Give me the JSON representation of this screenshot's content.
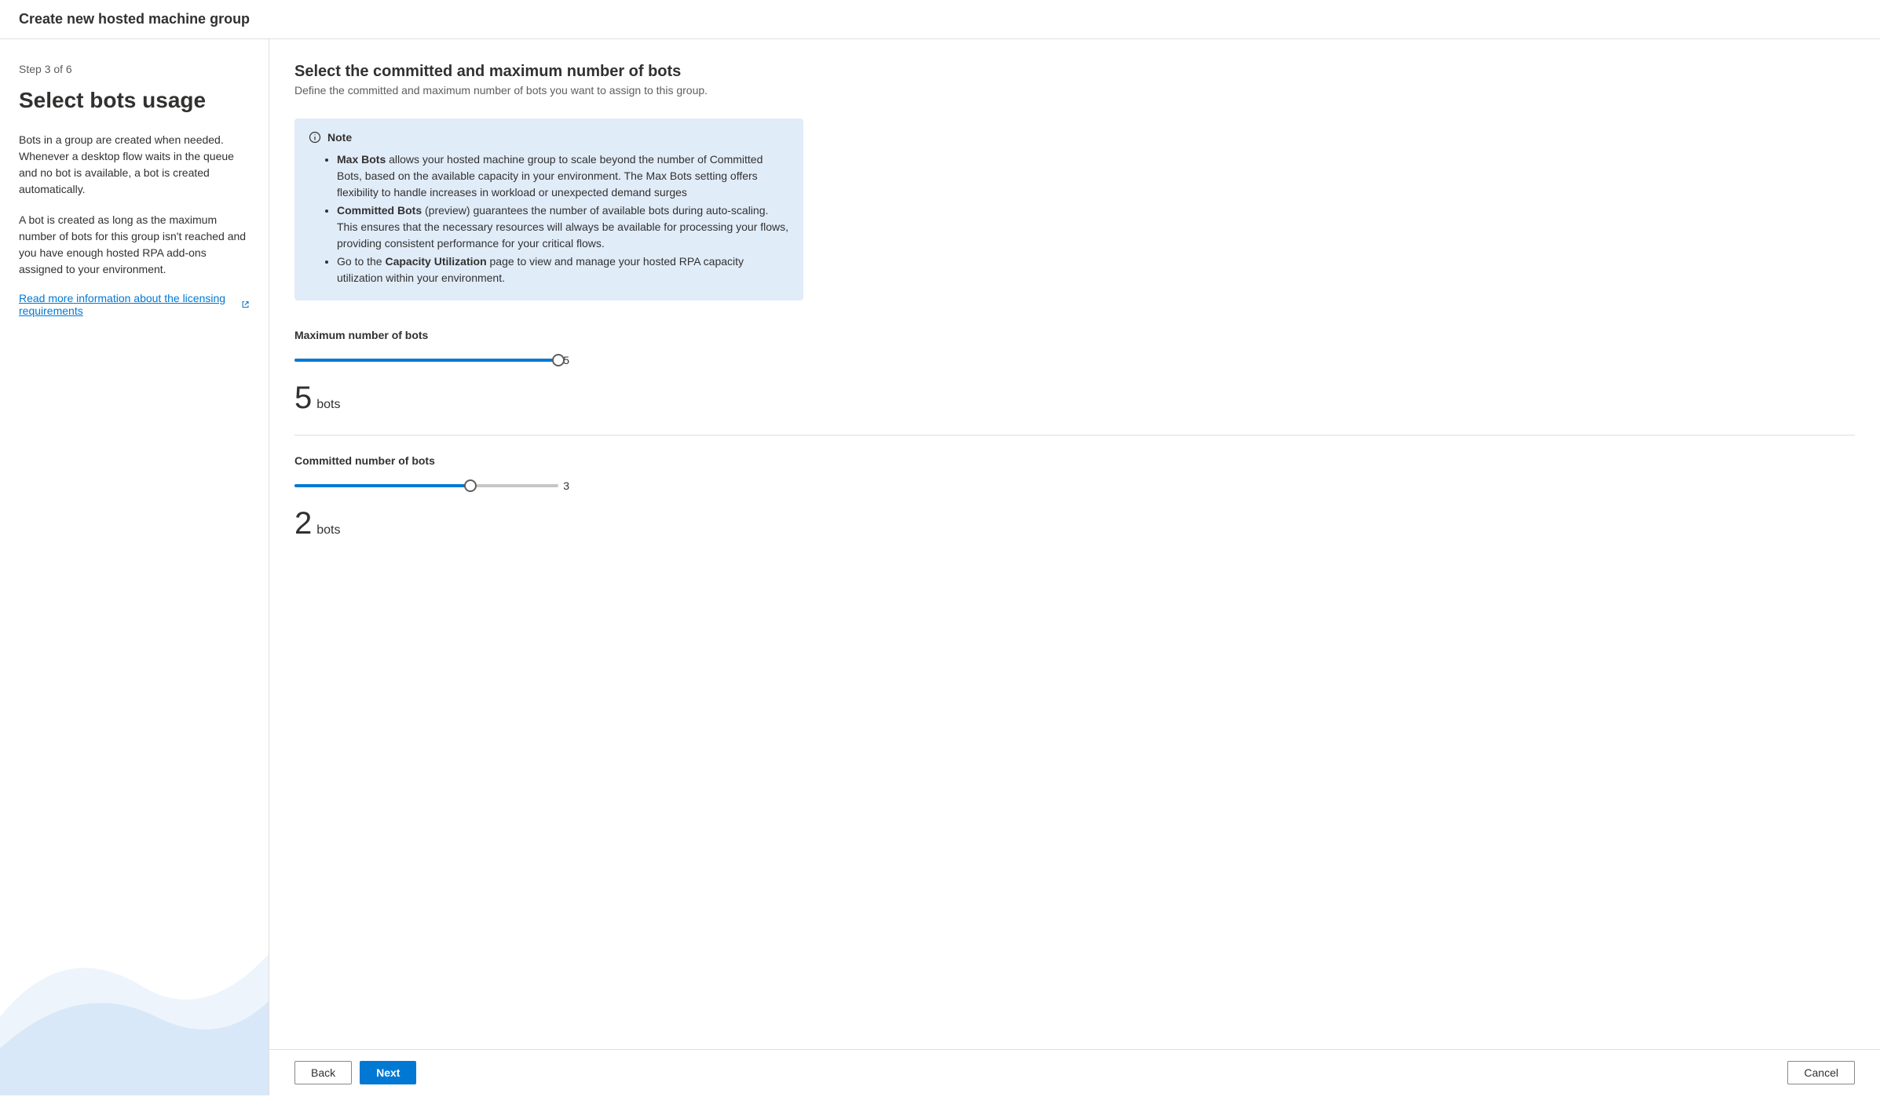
{
  "header": {
    "title": "Create new hosted machine group"
  },
  "sidebar": {
    "step_indicator": "Step 3 of 6",
    "title": "Select bots usage",
    "paragraph1": "Bots in a group are created when needed. Whenever a desktop flow waits in the queue and no bot is available, a bot is created automatically.",
    "paragraph2": "A bot is created as long as the maximum number of bots for this group isn't reached and you have enough hosted RPA add-ons assigned to your environment.",
    "link_text": "Read more information about the licensing requirements"
  },
  "main": {
    "title": "Select the committed and maximum number of bots",
    "subtitle": "Define the committed and maximum number of bots you want to assign to this group."
  },
  "note": {
    "label": "Note",
    "items": [
      {
        "bold": "Max Bots",
        "text": " allows your hosted machine group to scale beyond the number of Committed Bots, based on the available capacity in your environment. The Max Bots setting offers flexibility to handle increases in workload or unexpected demand surges"
      },
      {
        "bold": "Committed Bots",
        "text": " (preview) guarantees the number of available bots during auto-scaling. This ensures that the necessary resources will always be available for processing your flows, providing consistent performance for your critical flows."
      },
      {
        "prefix": "Go to the ",
        "bold": "Capacity Utilization",
        "text": " page to view and manage your hosted RPA capacity utilization within your environment."
      }
    ]
  },
  "sliders": {
    "max": {
      "label": "Maximum number of bots",
      "value": 5,
      "max": 5,
      "percent": 100,
      "display_value": "5",
      "display_unit": "bots",
      "max_label": "5"
    },
    "committed": {
      "label": "Committed number of bots",
      "value": 2,
      "max": 3,
      "percent": 66.67,
      "display_value": "2",
      "display_unit": "bots",
      "max_label": "3"
    }
  },
  "footer": {
    "back": "Back",
    "next": "Next",
    "cancel": "Cancel"
  }
}
